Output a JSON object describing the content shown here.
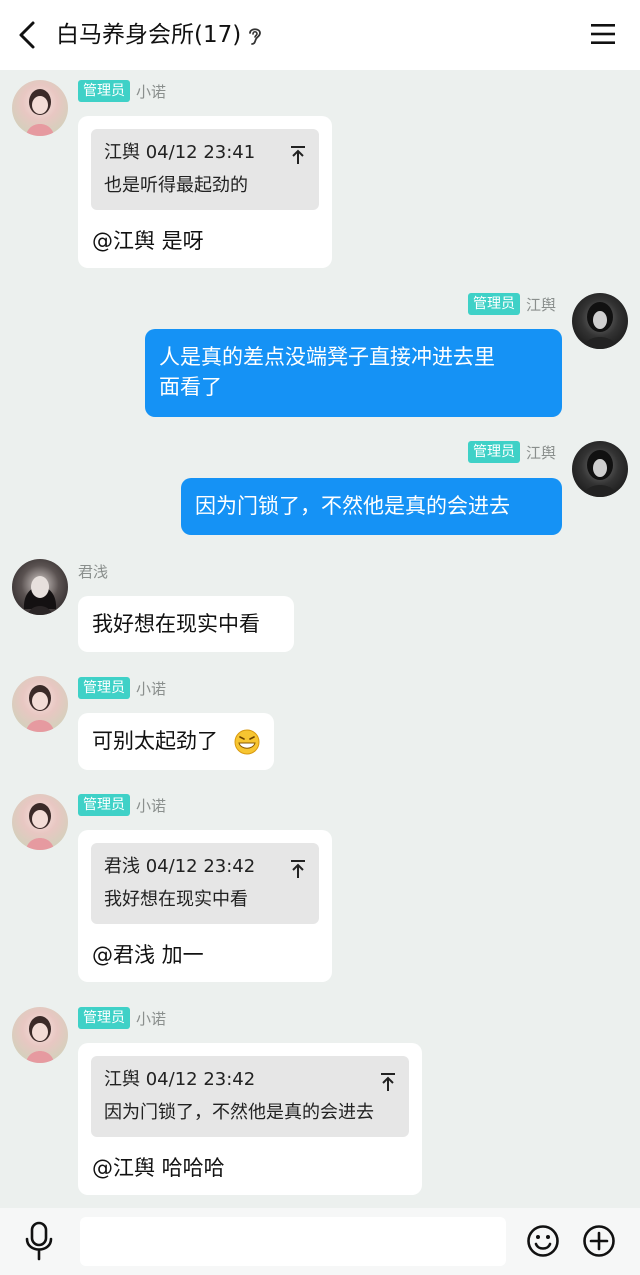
{
  "header": {
    "title": "白马养身会所(17)"
  },
  "messages": [
    {
      "sender": "小诺",
      "badge": "管理员",
      "quote": {
        "head": "江舆 04/12 23:41",
        "text": "也是听得最起劲的"
      },
      "text": "@江舆 是呀"
    },
    {
      "sender": "江舆",
      "badge": "管理员",
      "line1": "人是真的差点没端凳子直接冲进去里",
      "line2": "面看了"
    },
    {
      "sender": "江舆",
      "badge": "管理员",
      "text": "因为门锁了，不然他是真的会进去"
    },
    {
      "sender": "君浅",
      "text": "我好想在现实中看"
    },
    {
      "sender": "小诺",
      "badge": "管理员",
      "text": "可别太起劲了"
    },
    {
      "sender": "小诺",
      "badge": "管理员",
      "quote": {
        "head": "君浅 04/12 23:42",
        "text": "我好想在现实中看"
      },
      "text": "@君浅 加一"
    },
    {
      "sender": "小诺",
      "badge": "管理员",
      "quote": {
        "head": "江舆 04/12 23:42",
        "text": "因为门锁了，不然他是真的会进去"
      },
      "text": "@江舆 哈哈哈"
    }
  ],
  "input": {
    "value": ""
  },
  "colors": {
    "badge": "#3fd1c7",
    "my_bubble": "#1592f5",
    "background": "#ecf0ee"
  },
  "icons": [
    "back-arrow-icon",
    "ear-icon",
    "menu-icon",
    "pin-top-icon",
    "mic-icon",
    "emoji-icon",
    "plus-icon",
    "grin-emoji-icon"
  ]
}
